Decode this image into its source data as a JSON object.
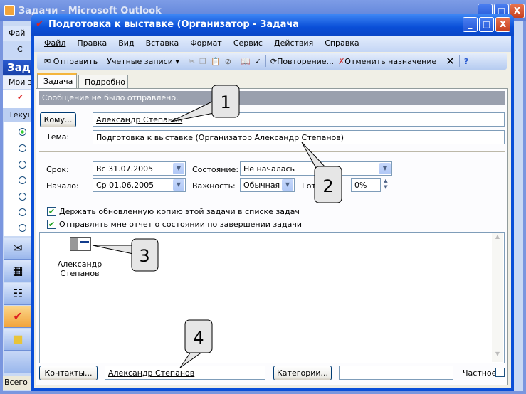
{
  "background_window": {
    "title": "Задачи - Microsoft Outlook",
    "menu_partial": "Фай",
    "toolbar_partial": "С",
    "header_partial": "Зад",
    "my_tasks_partial": "Мои з",
    "current_view_partial": "Текущ",
    "status_partial": "Всего э"
  },
  "window": {
    "title": "Подготовка к выставке (Организатор  - Задача",
    "controls": {
      "minimize": "_",
      "maximize": "□",
      "close": "X"
    }
  },
  "menu": [
    "Файл",
    "Правка",
    "Вид",
    "Вставка",
    "Формат",
    "Сервис",
    "Действия",
    "Справка"
  ],
  "toolbar": {
    "send": "Отправить",
    "accounts": "Учетные записи",
    "recurrence": "Повторение...",
    "cancel_assignment": "Отменить назначение"
  },
  "tabs": [
    "Задача",
    "Подробно"
  ],
  "info_bar": "Сообщение не было отправлено.",
  "form": {
    "to_button": "Кому...",
    "to_value": "Александр Степанов",
    "subject_label": "Тема:",
    "subject_value": "Подготовка к выставке (Организатор Александр Степанов)",
    "due_label": "Срок:",
    "due_value": "Вс 31.07.2005",
    "start_label": "Начало:",
    "start_value": "Ср 01.06.2005",
    "status_label": "Состояние:",
    "status_value": "Не началась",
    "priority_label": "Важность:",
    "priority_value": "Обычная",
    "complete_label": "Гот",
    "complete_value": "0%",
    "keep_copy": {
      "label": "Держать обновленную копию этой задачи в списке задач",
      "checked": true
    },
    "send_report": {
      "label": "Отправлять мне отчет о состоянии по завершении задачи",
      "checked": true
    },
    "attachment_name_line1": "Александр",
    "attachment_name_line2": "Степанов",
    "contacts_button": "Контакты...",
    "contacts_value": "Александр Степанов",
    "categories_button": "Категории...",
    "categories_value": "",
    "private_label": "Частное",
    "private_checked": false
  },
  "callouts": [
    "1",
    "2",
    "3",
    "4"
  ]
}
